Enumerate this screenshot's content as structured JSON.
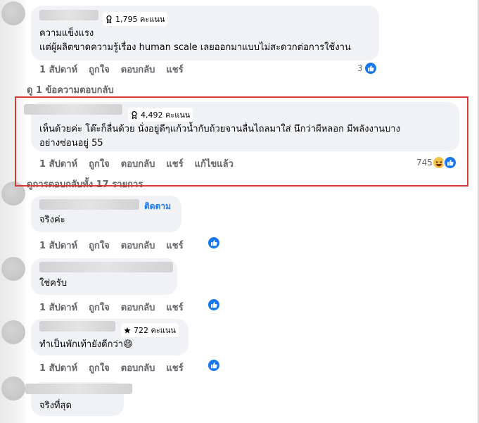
{
  "comments": [
    {
      "badge": "1,795 คะแนน",
      "text_lines": [
        "ความแข็งแรง",
        "แต่ผู้ผลิตขาดความรู้เรื่อง human scale เลยออกมาแบบไม่สะดวกต่อการใช้งาน"
      ],
      "time": "1 สัปดาห์",
      "like": "ถูกใจ",
      "reply": "ตอบกลับ",
      "share": "แชร์",
      "reaction_count": "3",
      "replies_link": "ดู 1 ข้อความตอบกลับ"
    },
    {
      "badge": "4,492 คะแนน",
      "text_lines": [
        "เห็นด้วยค่ะ โต๊ะก็ลื่นด้วย นั่งอยู่ดีๆแก้วน้ำกับถ้วยจานลื่นไถลมาใส่ นึกว่าผีหลอก มีพลังงานบาง",
        "อย่างซ่อนอยู่ 55"
      ],
      "time": "1 สัปดาห์",
      "like": "ถูกใจ",
      "reply": "ตอบกลับ",
      "share": "แชร์",
      "edited": "แก้ไขแล้ว",
      "reaction_count": "745",
      "replies_link": "ดูการตอบกลับทั้ง 17 รายการ"
    },
    {
      "follow": "ติดตาม",
      "text_lines": [
        "จริงค่ะ"
      ],
      "time": "1 สัปดาห์",
      "like": "ถูกใจ",
      "reply": "ตอบกลับ",
      "share": "แชร์"
    },
    {
      "text_lines": [
        "ใช่ครับ"
      ],
      "time": "1 สัปดาห์",
      "like": "ถูกใจ",
      "reply": "ตอบกลับ",
      "share": "แชร์"
    },
    {
      "badge": "722 คะแนน",
      "text_lines": [
        "ทำเป็นพักเท้ายังดีกว่า😄"
      ],
      "time": "1 สัปดาห์",
      "like": "ถูกใจ",
      "reply": "ตอบกลับ",
      "share": "แชร์"
    },
    {
      "text_lines": [
        "จริงที่สุด"
      ]
    }
  ],
  "colors": {
    "bubble": "#f0f2f5",
    "action_text": "#65676b",
    "like_blue": "#1877f2",
    "highlight_border": "#d9392f"
  },
  "icons": {
    "badge_icon": "award-ribbon-icon",
    "badge_icon_top_fan": "star-icon",
    "reaction_like": "thumbs-up-icon",
    "reaction_haha": "laughing-face-icon"
  }
}
